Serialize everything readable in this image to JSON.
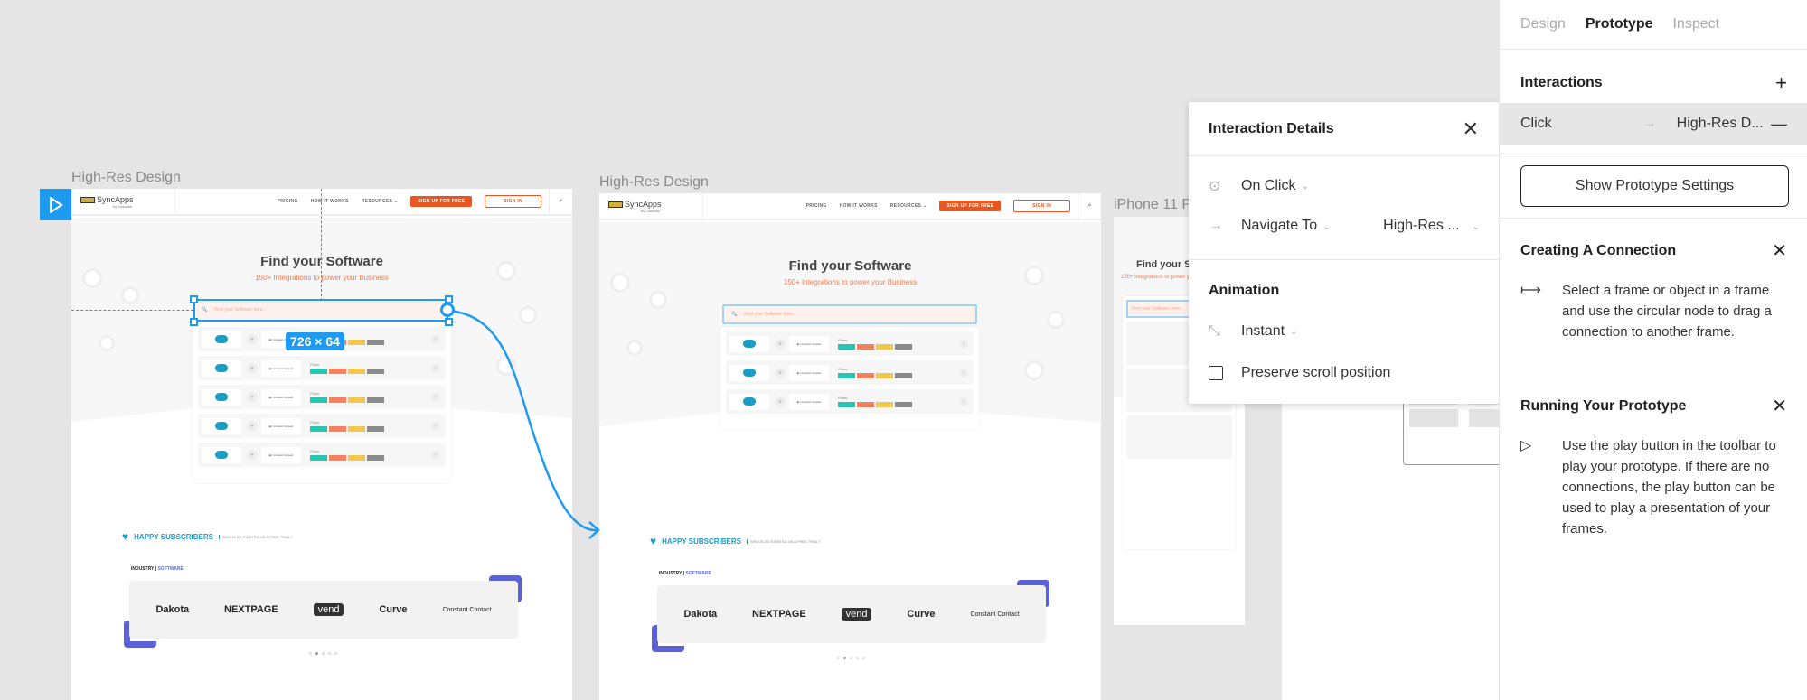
{
  "canvas": {
    "frames": [
      {
        "label": "High-Res Design"
      },
      {
        "label": "High-Res Design"
      },
      {
        "label": "iPhone 11 P"
      }
    ],
    "site": {
      "logo": "SyncApps",
      "logo_sub": "by Cazoomi",
      "nav": [
        "PRICING",
        "HOW IT WORKS",
        "RESOURCES ⌄"
      ],
      "signup": "SIGN UP FOR FREE",
      "signin": "SIGN IN",
      "hero_title": "Find your Software",
      "hero_sub": "150+ Integrations to power your Business",
      "search_placeholder": "Find your Software here...",
      "plans_label": "Plans:",
      "plan_colors": [
        "#26c6b0",
        "#f4825f",
        "#f3c64c",
        "#8a8a8a"
      ],
      "subscribers_title": "HAPPY SUBSCRIBERS",
      "subscribers_tagline": "WHO ELSE STARTED ON A FREE TRIAL?",
      "industry_label": "INDUSTRY |",
      "industry_value": "SOFTWARE",
      "logos": [
        "Dakota",
        "NEXTPAGE",
        "vend",
        "Curve",
        "Constant Contact"
      ],
      "carousel_active": 2,
      "carousel_count": 5
    },
    "selection_size": "726 × 64",
    "accent": "#1e9bf0"
  },
  "popup": {
    "title": "Interaction Details",
    "trigger": "On Click",
    "action": "Navigate To",
    "destination": "High-Res ...",
    "animation_title": "Animation",
    "animation": "Instant",
    "preserve_scroll_label": "Preserve scroll position",
    "preserve_scroll": false
  },
  "panel": {
    "tabs": [
      "Design",
      "Prototype",
      "Inspect"
    ],
    "active_tab": "Prototype",
    "interactions_title": "Interactions",
    "interaction": {
      "trigger": "Click",
      "target": "High-Res D..."
    },
    "show_settings": "Show Prototype Settings",
    "help": [
      {
        "title": "Creating A Connection",
        "text": "Select a frame or object in a frame and use the circular node to drag a connection to another frame."
      },
      {
        "title": "Running Your Prototype",
        "text": "Use the play button in the toolbar to play your prototype. If there are no connections, the play button can be used to play a presentation of your frames."
      }
    ]
  }
}
